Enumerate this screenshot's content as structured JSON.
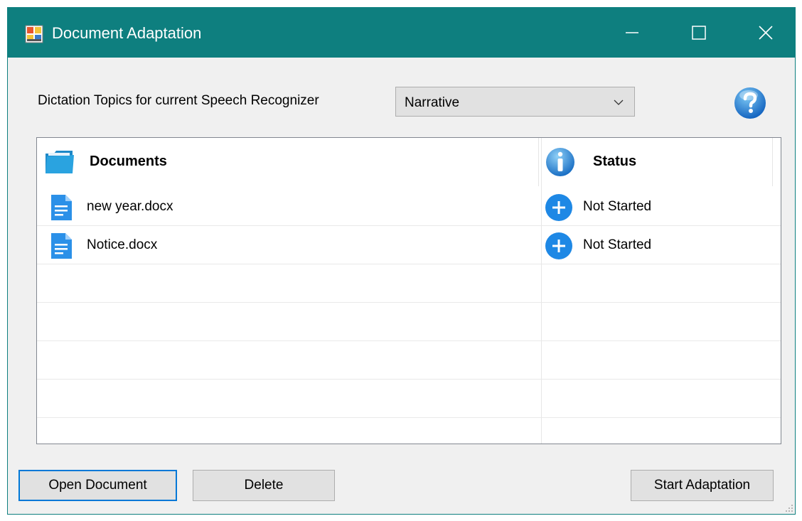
{
  "window": {
    "title": "Document Adaptation",
    "accent_color": "#0e7f7f"
  },
  "titlebar_icons": {
    "app": "app-window-icon",
    "minimize": "minimize-icon",
    "maximize": "maximize-icon",
    "close": "close-icon"
  },
  "topics": {
    "label": "Dictation Topics for current Speech Recognizer",
    "selected": "Narrative",
    "dropdown_icon": "chevron-down-icon",
    "help_icon": "help-icon"
  },
  "list": {
    "columns": [
      {
        "label": "Documents",
        "icon": "folder-icon"
      },
      {
        "label": "Status",
        "icon": "info-icon"
      }
    ],
    "rows": [
      {
        "name": "new year.docx",
        "icon": "document-icon",
        "status": "Not Started",
        "status_icon": "plus-circle-icon"
      },
      {
        "name": "Notice.docx",
        "icon": "document-icon",
        "status": "Not Started",
        "status_icon": "plus-circle-icon"
      }
    ]
  },
  "buttons": {
    "open": "Open Document",
    "delete": "Delete",
    "start": "Start Adaptation"
  }
}
